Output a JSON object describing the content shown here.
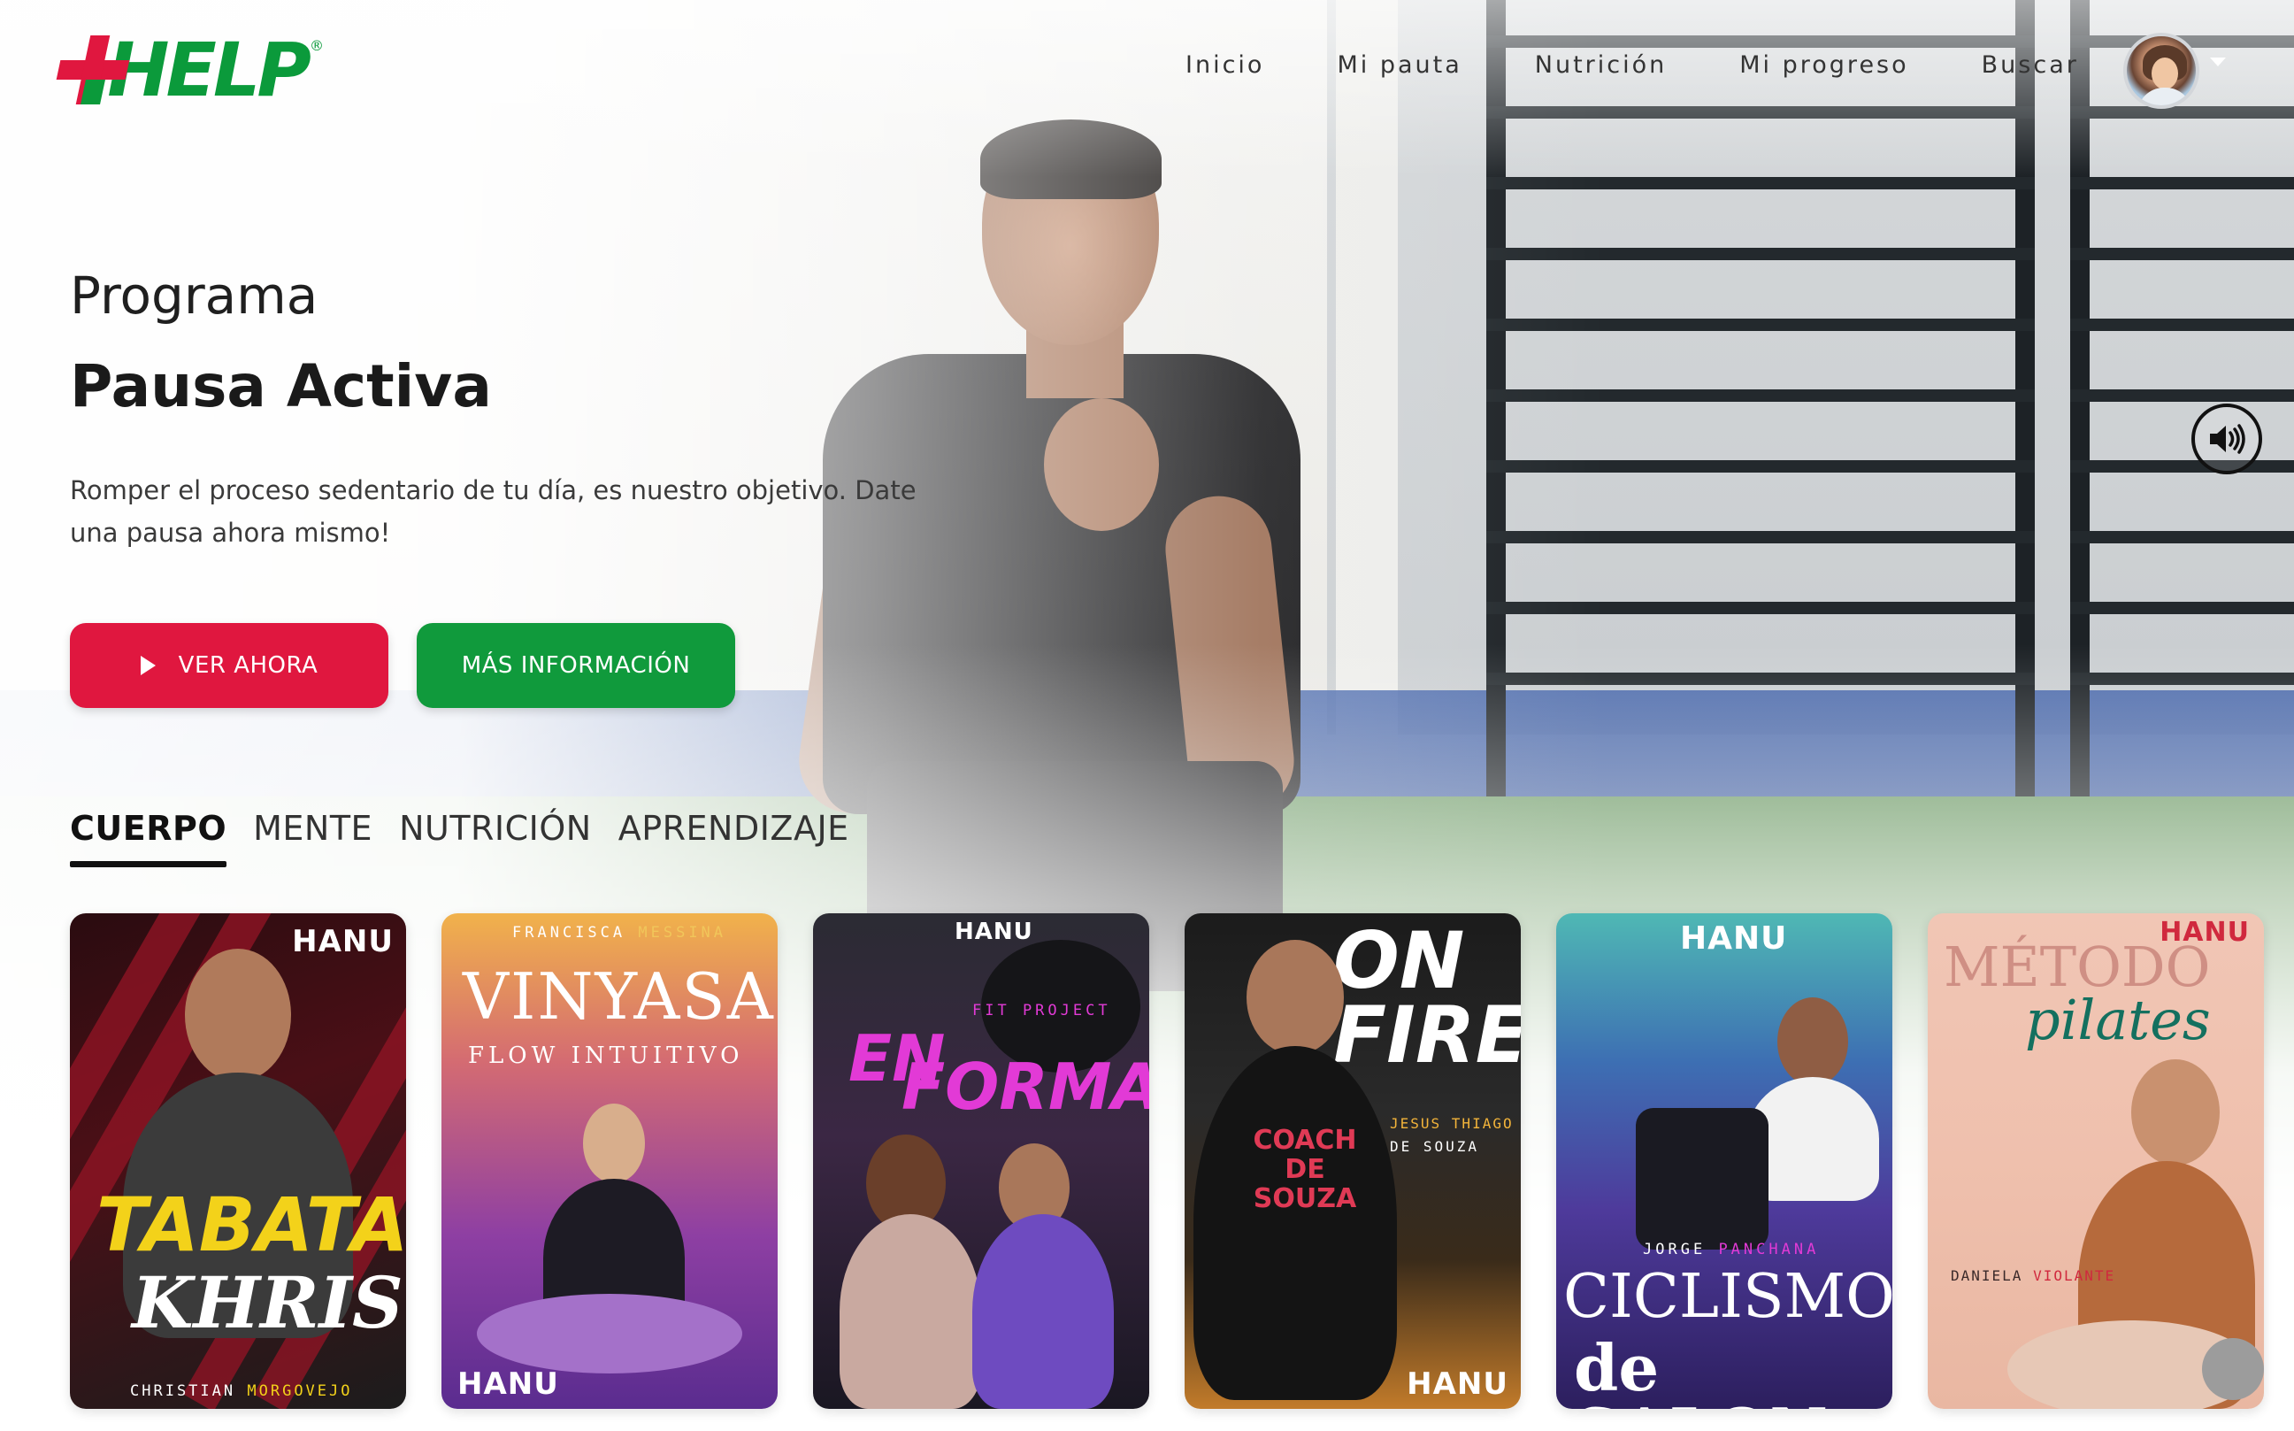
{
  "header": {
    "logo_text": "HELP",
    "logo_reg": "®",
    "nav": [
      "Inicio",
      "Mi pauta",
      "Nutrición",
      "Mi progreso",
      "Buscar"
    ]
  },
  "hero": {
    "kicker": "Programa",
    "title": "Pausa Activa",
    "description": "Romper el proceso sedentario de tu día, es nuestro objetivo. Date una pausa ahora mismo!",
    "play_button": "VER AHORA",
    "info_button": "MÁS INFORMACIÓN"
  },
  "tabs": [
    {
      "label": "CUERPO",
      "active": true
    },
    {
      "label": "MENTE",
      "active": false
    },
    {
      "label": "NUTRICIÓN",
      "active": false
    },
    {
      "label": "APRENDIZAJE",
      "active": false
    }
  ],
  "cards": [
    {
      "brand": "HANU",
      "title_line1": "TABATA",
      "title_line2": "KHRIS",
      "coach_first": "CHRISTIAN",
      "coach_last": "MORGOVEJO"
    },
    {
      "brand": "HANU",
      "coach_first": "FRANCISCA",
      "coach_last": "MESSINA",
      "title_line1": "VINYASA",
      "title_line2": "FLOW INTUITIVO"
    },
    {
      "brand": "HANU",
      "tag": "FIT PROJECT",
      "title_line1": "EN",
      "title_line2": "FORMA"
    },
    {
      "brand": "HANU",
      "title_line1": "ON",
      "title_line2": "FIRE",
      "coach_first": "JESUS THIAGO",
      "coach_last": "DE SOUZA",
      "shirt_text": "COACH DE SOUZA"
    },
    {
      "brand": "HANU",
      "coach_first": "JORGE",
      "coach_last": "PANCHANA",
      "title_line1": "CICLISMO",
      "title_line2": "de SALON"
    },
    {
      "brand": "HANU",
      "title_line1": "MÉTODO",
      "title_line2": "pilates",
      "coach_first": "DANIELA",
      "coach_last": "VIOLANTE"
    }
  ],
  "colors": {
    "brand_red": "#e0173f",
    "brand_green": "#0b9a3b",
    "info_green": "#109a3c"
  },
  "icons": {
    "sound": "speaker-volume-icon",
    "play": "play-icon",
    "caret": "caret-down-icon"
  }
}
